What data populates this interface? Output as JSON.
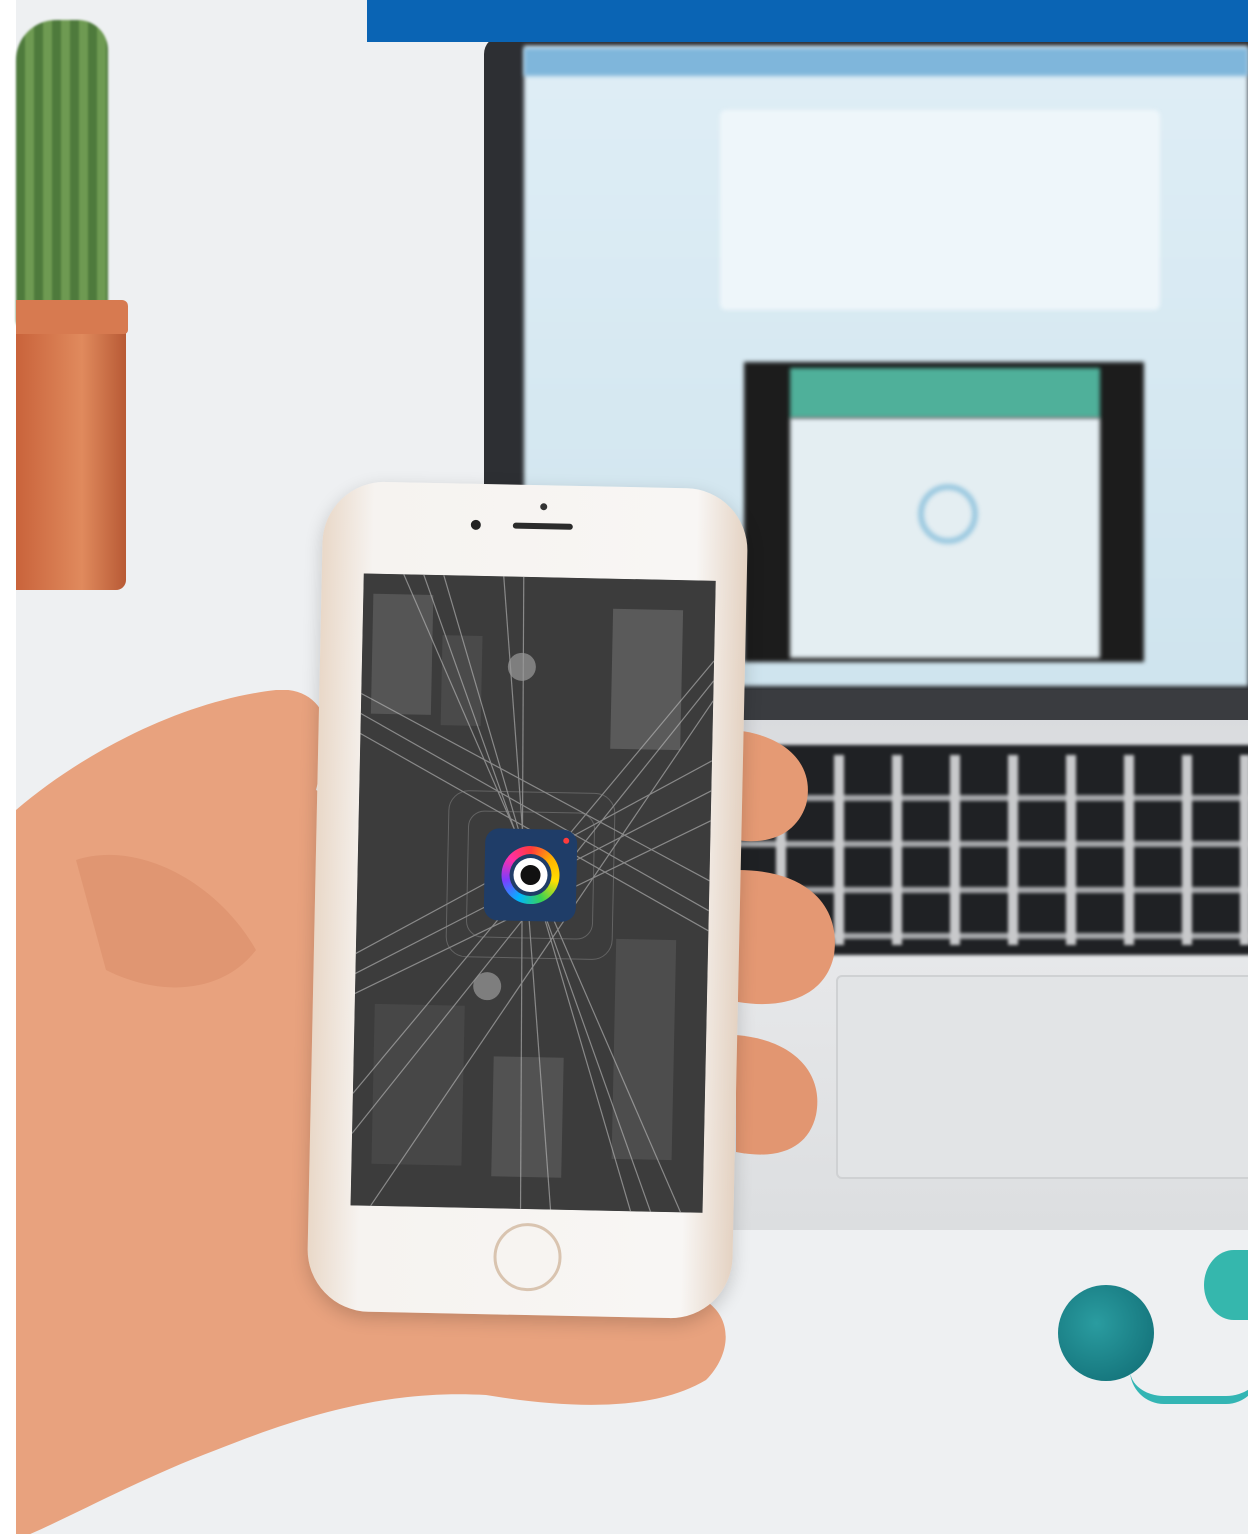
{
  "colors": {
    "top_bar": "#0a64b4",
    "app_icon_bg": "#1f3d68",
    "earbud": "#2a9ca0"
  },
  "icons": {
    "app": "camera-lens-icon",
    "home": "home-button-icon"
  }
}
